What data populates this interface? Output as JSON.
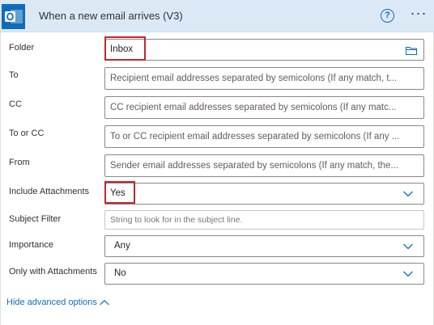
{
  "header": {
    "title": "When a new email arrives (V3)",
    "help_glyph": "?",
    "more_glyph": "···",
    "bg_color": "#dbe9f7",
    "brand_color": "#0f6cbd"
  },
  "fields": {
    "folder": {
      "label": "Folder",
      "value": "Inbox"
    },
    "to": {
      "label": "To",
      "placeholder": "Recipient email addresses separated by semicolons (If any match, t..."
    },
    "cc": {
      "label": "CC",
      "placeholder": "CC recipient email addresses separated by semicolons (If any matc..."
    },
    "to_or_cc": {
      "label": "To or CC",
      "placeholder": "To or CC recipient email addresses separated by semicolons (If any ..."
    },
    "from": {
      "label": "From",
      "placeholder": "Sender email addresses separated by semicolons (If any match, the..."
    },
    "include_attachments": {
      "label": "Include Attachments",
      "value": "Yes"
    },
    "subject_filter": {
      "label": "Subject Filter",
      "placeholder": "String to look for in the subject line."
    },
    "importance": {
      "label": "Importance",
      "value": "Any"
    },
    "only_with_attachments": {
      "label": "Only with Attachments",
      "value": "No"
    }
  },
  "footer": {
    "advanced_label": "Hide advanced options"
  },
  "icons": {
    "app": "outlook-icon",
    "help": "help-icon",
    "more": "more-options-icon",
    "folder": "folder-picker-icon",
    "dropdown": "chevron-down-icon",
    "collapse": "chevron-up-icon"
  },
  "highlight_color": "#c1272d"
}
